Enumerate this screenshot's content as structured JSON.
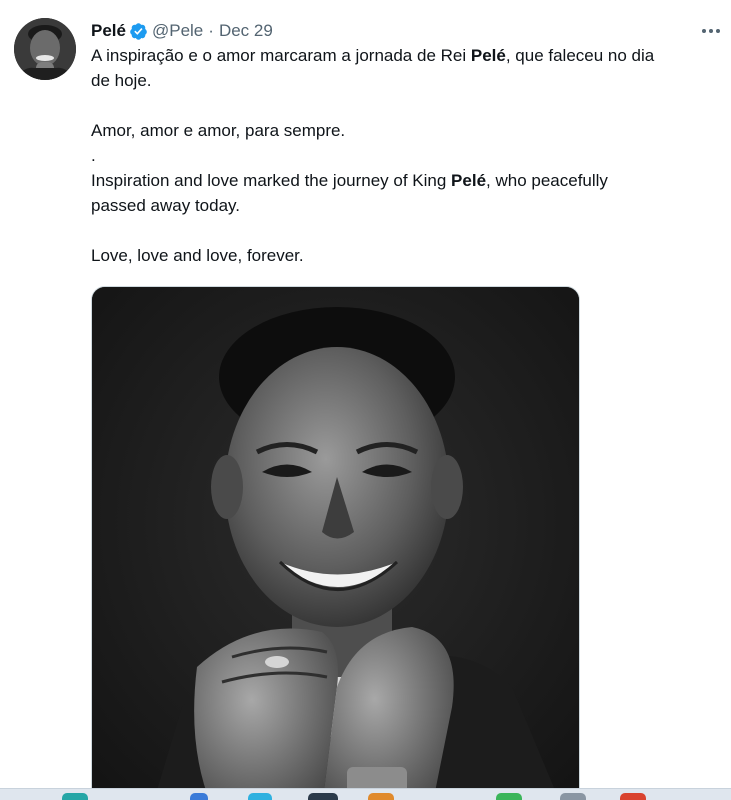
{
  "author": {
    "name": "Pelé",
    "handle": "@Pele",
    "separator": "·",
    "date": "Dec 29",
    "verified": true,
    "avatar_icon": "avatar-photo"
  },
  "tweet": {
    "pt_line1_before": "A inspiração e o amor marcaram a jornada de Rei ",
    "pt_line1_bold": "Pelé",
    "pt_line1_after": ", que faleceu no dia",
    "pt_line2": "de hoje.",
    "pt_line3": "Amor, amor e amor, para sempre.",
    "dot_line": ".",
    "en_line1_before": "Inspiration and love marked the journey of King ",
    "en_line1_bold": "Pelé",
    "en_line1_after": ", who peacefully",
    "en_line2": "passed away today.",
    "en_line3": "Love, love and love, forever."
  },
  "media": {
    "alt": "Black and white portrait photo",
    "icon": "photo"
  },
  "colors": {
    "verified_blue": "#1d9bf0",
    "secondary_text": "#536471",
    "primary_text": "#0f1419",
    "media_border": "#cfd9de"
  },
  "taskbar_icons": [
    {
      "name": "taskbar-app-teal-icon",
      "color": "#25a6a6"
    },
    {
      "name": "taskbar-app-blue-icon",
      "color": "#3b7bd8"
    },
    {
      "name": "taskbar-app-cyan-icon",
      "color": "#2fb1e0"
    },
    {
      "name": "taskbar-app-dark-icon",
      "color": "#2b3a4a"
    },
    {
      "name": "taskbar-app-orange-icon",
      "color": "#e08a2c"
    },
    {
      "name": "taskbar-app-green-icon",
      "color": "#3bb55a"
    },
    {
      "name": "taskbar-app-gray-icon",
      "color": "#8a96a3"
    },
    {
      "name": "taskbar-app-red-icon",
      "color": "#d9432f"
    }
  ]
}
